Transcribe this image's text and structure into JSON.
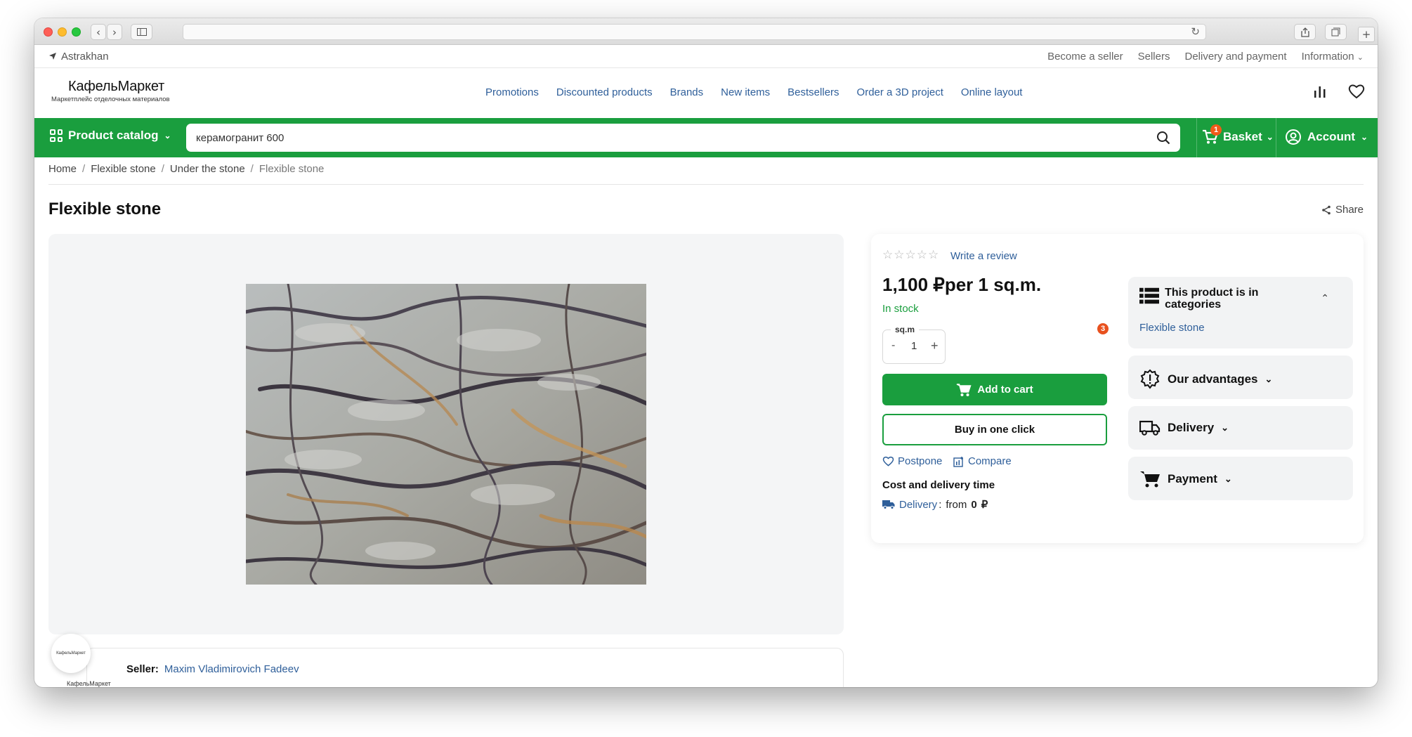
{
  "browser": {
    "title": ""
  },
  "topbar": {
    "city": "Astrakhan",
    "links": [
      "Become a seller",
      "Sellers",
      "Delivery and payment",
      "Information"
    ]
  },
  "header": {
    "logo_name": "КафельМаркет",
    "logo_tagline": "Маркетплейс отделочных материалов",
    "nav": [
      "Promotions",
      "Discounted products",
      "Brands",
      "New items",
      "Bestsellers",
      "Order a 3D project",
      "Online layout"
    ]
  },
  "greenbar": {
    "catalog_label": "Product catalog",
    "search_value": "керамогранит 600",
    "basket_label": "Basket",
    "basket_count": "1",
    "account_label": "Account"
  },
  "breadcrumb": [
    "Home",
    "Flexible stone",
    "Under the stone",
    "Flexible stone"
  ],
  "page": {
    "title": "Flexible stone",
    "share_label": "Share"
  },
  "product": {
    "rating_stars": 0,
    "write_review": "Write a review",
    "price": "1,100  ₽per 1 sq.m.",
    "stock": "In stock",
    "notification_count": "3",
    "qty_unit": "sq.m",
    "qty_value": "1",
    "qty_minus": "-",
    "qty_plus": "+",
    "add_to_cart": "Add to cart",
    "buy_one_click": "Buy in one click",
    "postpone": "Postpone",
    "compare": "Compare",
    "cost_title": "Cost and delivery time",
    "delivery_link": "Delivery",
    "delivery_colon": ":",
    "delivery_from": "from",
    "delivery_amount": "0",
    "delivery_currency": "₽"
  },
  "side": {
    "categories_title": "This product is in categories",
    "category_link": "Flexible stone",
    "advantages": "Our advantages",
    "delivery": "Delivery",
    "payment": "Payment"
  },
  "seller": {
    "label": "Seller:",
    "name": "Maxim Vladimirovich Fadeev",
    "logo_text": "КафельМаркет"
  },
  "colors": {
    "brand_green": "#1a9e3e",
    "link_blue": "#2f5f9a",
    "badge_orange": "#f05a1a"
  }
}
